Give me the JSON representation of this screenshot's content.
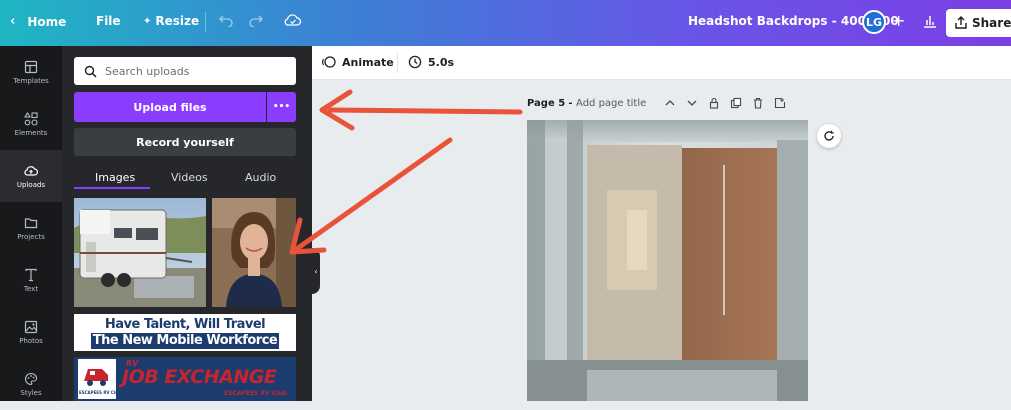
{
  "topbar": {
    "home": "Home",
    "file": "File",
    "resize": "Resize",
    "doc_title": "Headshot Backdrops - 400x400",
    "avatar_initials": "LG",
    "share": "Share"
  },
  "rail": {
    "items": [
      {
        "label": "Templates",
        "icon": "templates-icon"
      },
      {
        "label": "Elements",
        "icon": "elements-icon"
      },
      {
        "label": "Uploads",
        "icon": "cloud-upload-icon"
      },
      {
        "label": "Projects",
        "icon": "folder-icon"
      },
      {
        "label": "Text",
        "icon": "text-icon"
      },
      {
        "label": "Photos",
        "icon": "photo-icon"
      },
      {
        "label": "Styles",
        "icon": "palette-icon"
      }
    ]
  },
  "panel": {
    "search_placeholder": "Search uploads",
    "upload_label": "Upload files",
    "more_label": "•••",
    "record_label": "Record yourself",
    "tabs": [
      "Images",
      "Videos",
      "Audio"
    ],
    "banner1_line1": "Have Talent, Will Travel",
    "banner1_line2": "The New Mobile Workforce",
    "banner2_text": "JOB EXCHANGE",
    "banner2_small": "RV",
    "banner2_brand": "ESCAPEES RV Club",
    "logo_text": "ESCAPEES RV Club"
  },
  "editor": {
    "animate": "Animate",
    "duration": "5.0s",
    "page_label": "Page 5",
    "page_title_placeholder": "Add page title"
  },
  "colors": {
    "accent": "#8b3dff",
    "annotation": "#e8533a"
  }
}
